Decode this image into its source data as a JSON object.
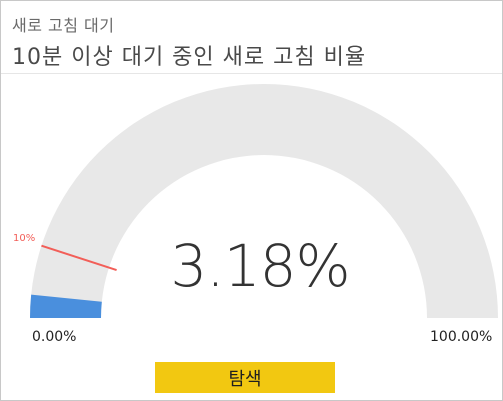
{
  "tile": {
    "subtitle": "새로 고침 대기",
    "title": "10분 이상 대기 중인 새로 고침 비율"
  },
  "gauge": {
    "value_label": "3.18%",
    "value": 3.18,
    "min_label": "0.00%",
    "min": 0,
    "max_label": "100.00%",
    "max": 100,
    "target_label": "10%",
    "target": 10,
    "colors": {
      "track": "#e8e8e8",
      "fill": "#4a8fdd",
      "target": "#f25e58"
    }
  },
  "actions": {
    "explore_label": "탐색"
  }
}
